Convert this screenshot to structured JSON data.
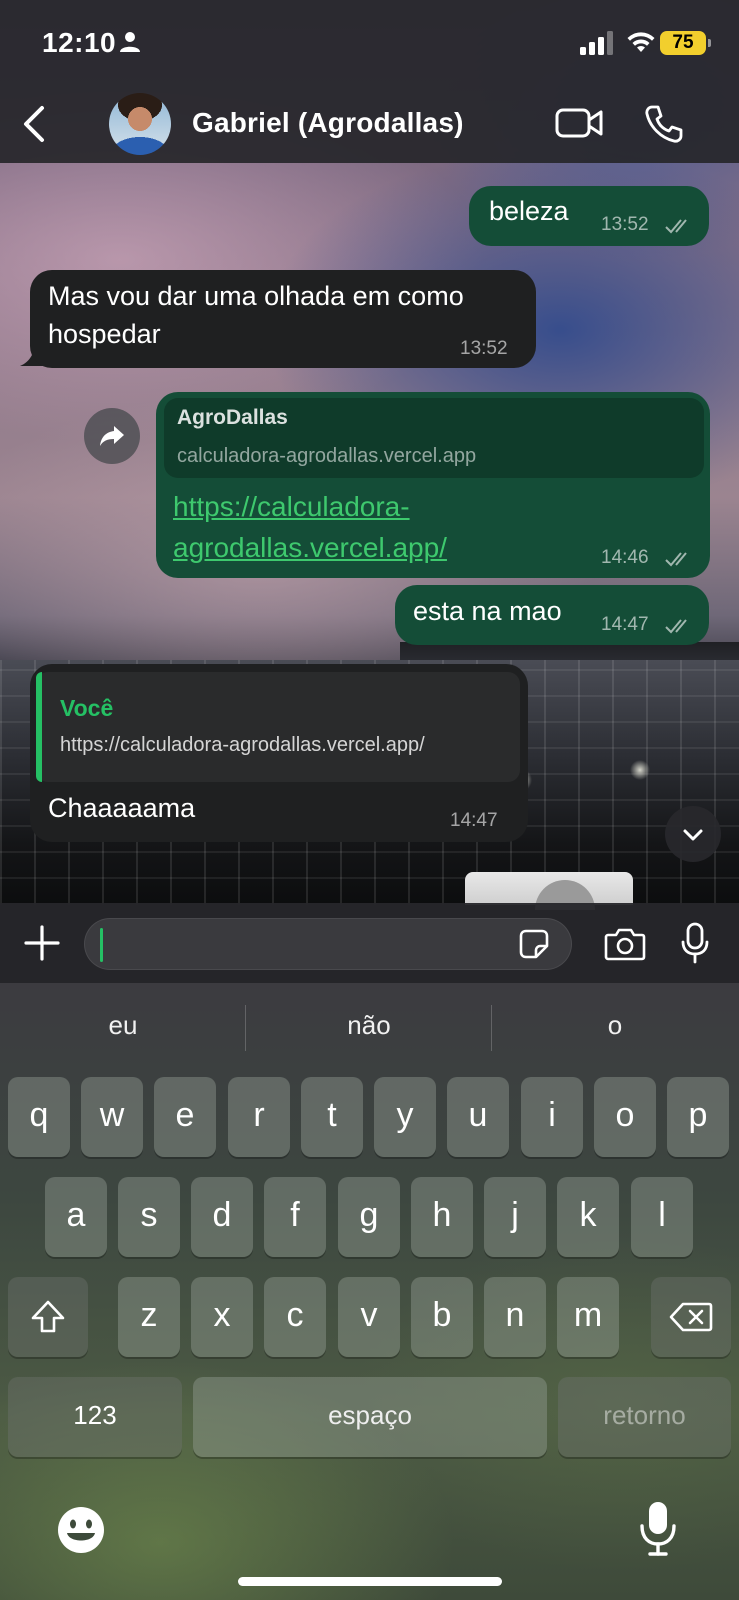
{
  "status_bar": {
    "time": "12:10",
    "battery": "75"
  },
  "header": {
    "contact_name": "Gabriel (Agrodallas)"
  },
  "messages": [
    {
      "direction": "out",
      "text": "beleza",
      "time": "13:52"
    },
    {
      "direction": "in",
      "text_lines": [
        "Mas vou dar uma olhada em como",
        "hospedar"
      ],
      "time": "13:52"
    },
    {
      "direction": "out",
      "preview_title": "AgroDallas",
      "preview_url": "calculadora-agrodallas.vercel.app",
      "link_lines": [
        "https://calculadora-",
        "agrodallas.vercel.app/"
      ],
      "time": "14:46"
    },
    {
      "direction": "out",
      "text": "esta na mao",
      "time": "14:47"
    },
    {
      "direction": "in",
      "quote_author": "Você",
      "quote_text": "https://calculadora-agrodallas.vercel.app/",
      "text": "Chaaaaama",
      "time": "14:47"
    }
  ],
  "composer": {
    "value": "",
    "placeholder": ""
  },
  "keyboard": {
    "suggestions": [
      "eu",
      "não",
      "o"
    ],
    "row1": [
      "q",
      "w",
      "e",
      "r",
      "t",
      "y",
      "u",
      "i",
      "o",
      "p"
    ],
    "row2": [
      "a",
      "s",
      "d",
      "f",
      "g",
      "h",
      "j",
      "k",
      "l"
    ],
    "row3": [
      "z",
      "x",
      "c",
      "v",
      "b",
      "n",
      "m"
    ],
    "numbers_label": "123",
    "space_label": "espaço",
    "return_label": "retorno"
  },
  "colors": {
    "outgoing_bubble": "#144d37",
    "incoming_bubble": "#1f2021",
    "accent": "#25c064",
    "link": "#3ec96e",
    "battery": "#f2cf2d"
  },
  "icons": [
    "person-icon",
    "signal-icon",
    "wifi-icon",
    "back-icon",
    "video-call-icon",
    "phone-call-icon",
    "forward-icon",
    "double-check-icon",
    "chevron-down-icon",
    "plus-icon",
    "sticker-icon",
    "camera-icon",
    "mic-icon",
    "shift-icon",
    "backspace-icon",
    "emoji-icon"
  ]
}
